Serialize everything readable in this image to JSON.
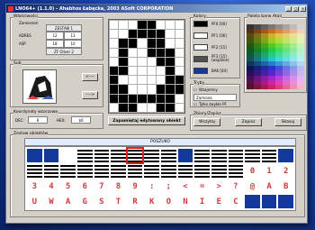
{
  "window": {
    "title": "LNO64+ (1.1.0) - Ahabhos Łabęcka, 2003 ASoft CORPORATION"
  },
  "left": {
    "group_title": "Właściwości",
    "sub_title": "Zamierzeń",
    "table_header": "ZESTAW 1",
    "rows": [
      {
        "label": "ADRES",
        "val1": "12",
        "val2": "13"
      },
      {
        "label": "ASP",
        "val1": "18",
        "val2": "10"
      }
    ],
    "sprite_label": "ZF Oliver 2",
    "sub_label": "Sub",
    "btn1": "<----",
    "btn2": "---->",
    "coords_title": "Koordynaty wzorzowe",
    "dec_label": "DEC:",
    "dec_value": "6",
    "hex_label": "HEX:",
    "hex_value": "$6"
  },
  "editor": {
    "save_button": "Zapamiętaj edytowany obiekt"
  },
  "colors": {
    "group_title": "Kolory",
    "items": [
      {
        "label": "PF0 [00]",
        "color": "#000000"
      },
      {
        "label": "PF1 [06]",
        "color": "#ffffff"
      },
      {
        "label": "PF2 [15]",
        "color": "#ffffff"
      },
      {
        "label": "PF3 [15] (wspólne)",
        "color": "#505050"
      },
      {
        "label": "BAK [00]",
        "color": "#13399c"
      }
    ]
  },
  "palette": {
    "title": "Paleta barw Atari"
  },
  "mode": {
    "group_title": "Tryby",
    "check1": "Wzajemny",
    "select_value": "Zamiana",
    "check2": "Tylko zwykłe PF"
  },
  "file": {
    "group_title": "Zbiory/Zapisz",
    "load": "Wczytaj",
    "save": "Zapisz",
    "clear": "Skasuj"
  },
  "tiles": {
    "group_title": "Zestaw obiektów",
    "strip_label": "POSZUKO",
    "row3": [
      "3",
      "4",
      "5",
      "6",
      "7",
      "8",
      "9",
      ":",
      ";",
      "<",
      "=",
      ">",
      "?",
      "@",
      "A",
      "B"
    ],
    "row4": [
      "U",
      "W",
      "A",
      "G",
      "S",
      "T",
      "R",
      "K",
      "O",
      "N",
      "I",
      "E",
      "C",
      "",
      "",
      ""
    ]
  }
}
